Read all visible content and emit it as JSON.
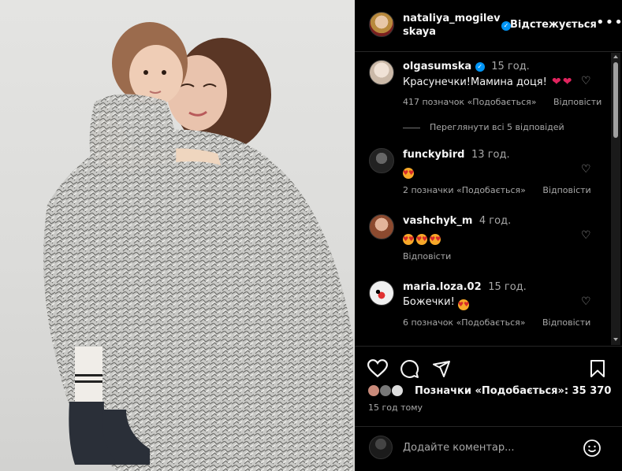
{
  "post": {
    "author": "nataliya_mogilevskaya",
    "follow_label": "Відстежується"
  },
  "comments": [
    {
      "user": "olgasumska",
      "time": "15 год.",
      "text": "Красунечки!Мамина доця!",
      "likes": "417 позначок «Подобається»",
      "reply": "Відповісти",
      "verified": true,
      "avatar_color": "#d8cfc6"
    },
    {
      "user": "funckybird",
      "time": "13 год.",
      "text": "",
      "likes": "2 позначки «Подобається»",
      "reply": "Відповісти",
      "avatar_color": "#2d2d2d"
    },
    {
      "user": "vashchyk_m",
      "time": "4 год.",
      "text": "",
      "likes": "",
      "reply": "Відповісти",
      "avatar_color": "#9b5b3c"
    },
    {
      "user": "maria.loza.02",
      "time": "15 год.",
      "text": "Божечки!",
      "likes": "6 позначок «Подобається»",
      "reply": "Відповісти",
      "avatar_color": "#e8e8e8"
    }
  ],
  "view_replies": "Переглянути всі 5 відповідей",
  "likes_summary": "Позначки «Подобається»: 35 370",
  "posted_ago": "15 год тому",
  "composer": {
    "placeholder": "Додайте коментар..."
  },
  "icons": [
    "more-icon",
    "heart-icon",
    "comment-icon",
    "share-icon",
    "bookmark-icon",
    "emoji-icon"
  ],
  "colors": {
    "panel_bg": "#000000",
    "verified": "#0095f6",
    "secondary_text": "#a8a8a8"
  }
}
